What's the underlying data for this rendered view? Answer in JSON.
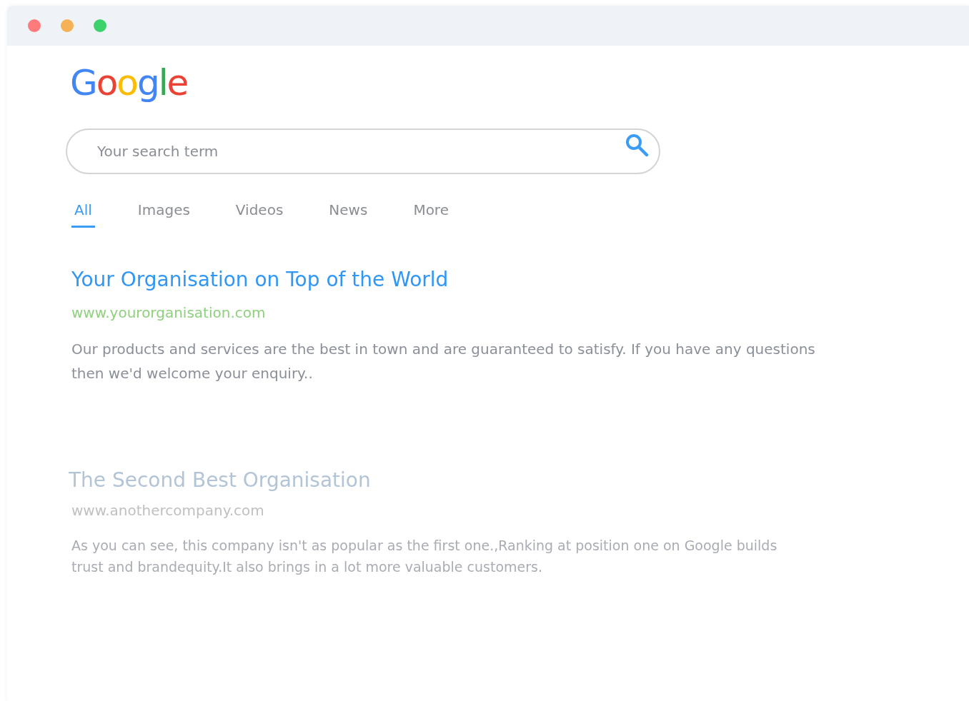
{
  "window": {
    "controls": [
      {
        "color": "#ff7b7b"
      },
      {
        "color": "#f5b155"
      },
      {
        "color": "#3dd26b"
      }
    ]
  },
  "logo": {
    "text": "Google"
  },
  "search": {
    "placeholder": "Your search term"
  },
  "tabs": [
    {
      "label": "All",
      "selected": true
    },
    {
      "label": "Images",
      "selected": false
    },
    {
      "label": "Videos",
      "selected": false
    },
    {
      "label": "News",
      "selected": false
    },
    {
      "label": "More",
      "selected": false
    }
  ],
  "results": [
    {
      "title": "Your Organisation on Top of the World",
      "url": "www.yourorganisation.com",
      "description": "Our products and services are the best in town and are guaranteed to satisfy. If you have any questions then we'd welcome your enquiry..",
      "faded": false
    },
    {
      "title": "The Second Best Organisation",
      "url": "www.anothercompany.com",
      "description": "As you can see, this company isn't as popular as the first one.,Ranking at position one on Google builds trust and brandequity.It also brings in a lot more valuable customers.",
      "faded": true
    }
  ]
}
